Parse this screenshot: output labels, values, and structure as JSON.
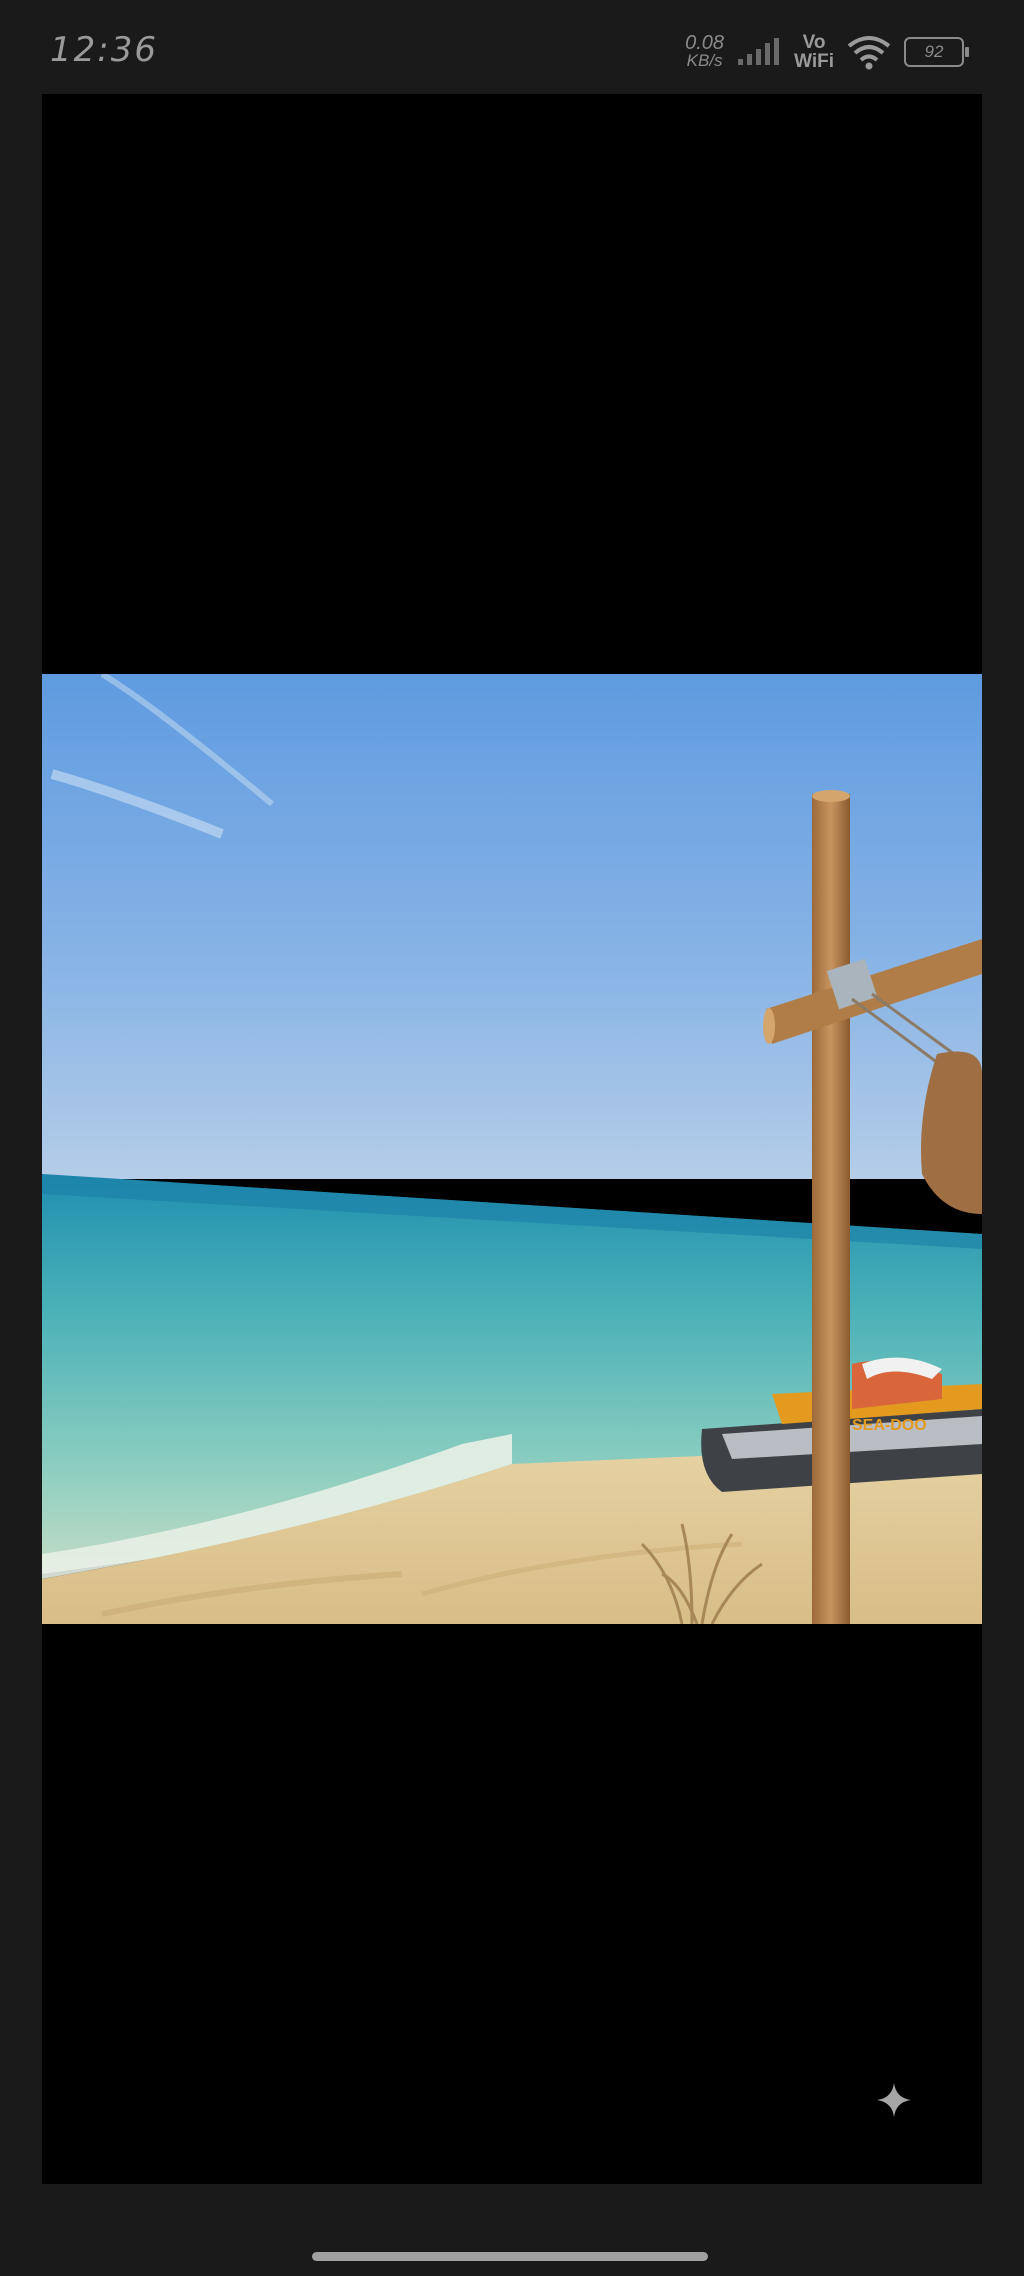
{
  "status_bar": {
    "time": "12:36",
    "net_speed_value": "0.08",
    "net_speed_unit": "KB/s",
    "vowifi_top": "Vo",
    "vowifi_bottom": "WiFi",
    "battery": "92",
    "icons": [
      "signal-icon",
      "wifi-icon",
      "battery-icon"
    ]
  },
  "viewer": {
    "background": "#000000",
    "photo": {
      "description_icon": "beach-photo",
      "watercraft_label": "SEA-DOO"
    },
    "action_icon": "sparkle-icon"
  }
}
